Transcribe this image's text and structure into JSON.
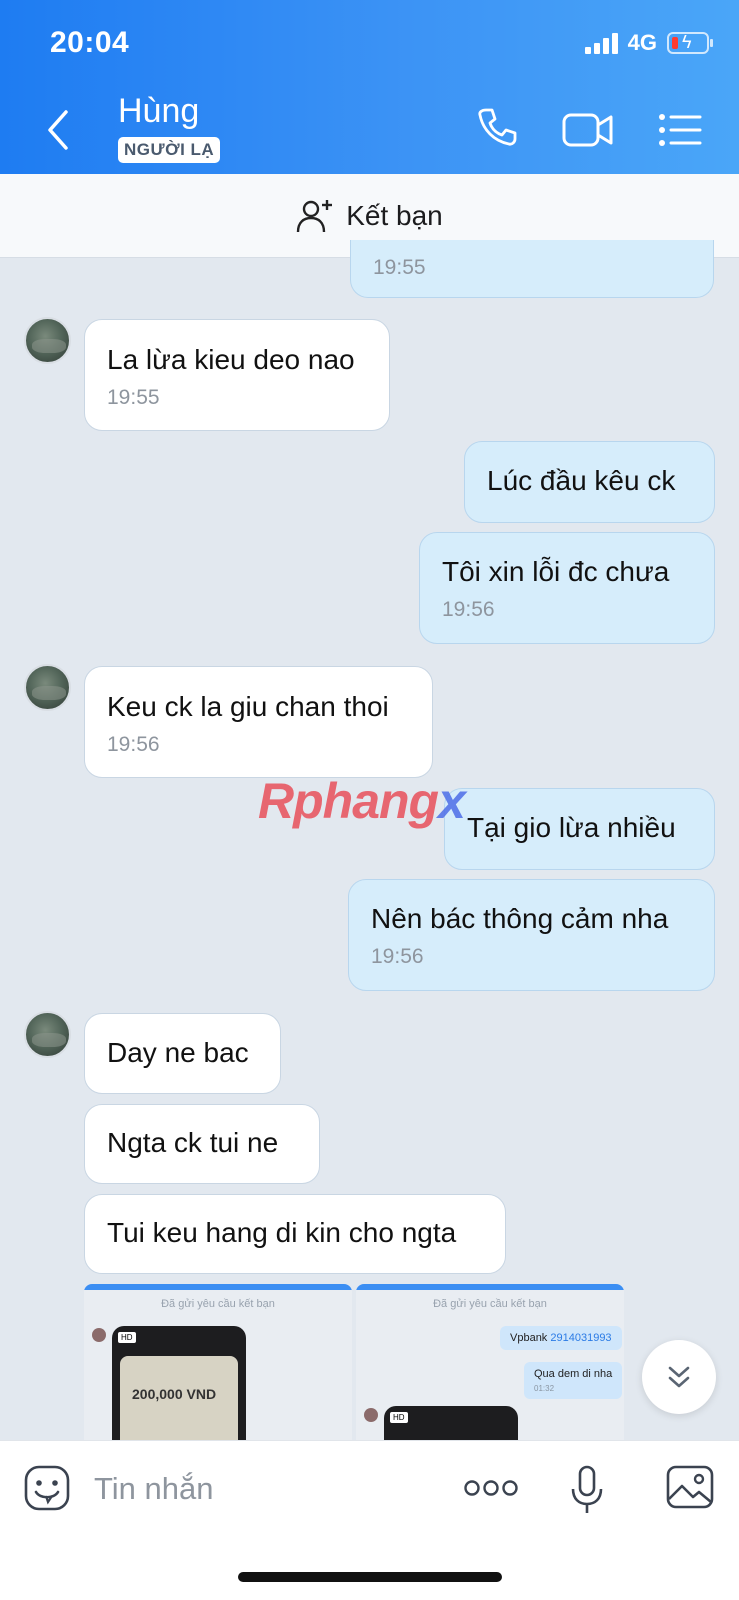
{
  "status_bar": {
    "time": "20:04",
    "network": "4G"
  },
  "header": {
    "contact_name": "Hùng",
    "badge": "NGƯỜI LẠ"
  },
  "friend_bar": {
    "label": "Kết bạn"
  },
  "messages": [
    {
      "dir": "out",
      "text": "",
      "time": "19:55"
    },
    {
      "dir": "in",
      "text": "La lừa kieu deo nao",
      "time": "19:55"
    },
    {
      "dir": "out",
      "text": "Lúc đầu kêu ck",
      "time": ""
    },
    {
      "dir": "out",
      "text": "Tôi xin lỗi đc chưa",
      "time": "19:56"
    },
    {
      "dir": "in",
      "text": "Keu ck la giu chan thoi",
      "time": "19:56"
    },
    {
      "dir": "out",
      "text": "Tại gio lừa nhiều",
      "time": ""
    },
    {
      "dir": "out",
      "text": "Nên bác thông cảm nha",
      "time": "19:56"
    },
    {
      "dir": "in",
      "text": "Day ne bac",
      "time": ""
    },
    {
      "dir": "in",
      "text": "Ngta ck tui ne",
      "time": ""
    },
    {
      "dir": "in",
      "text": "Tui keu hang di kin cho ngta",
      "time": ""
    }
  ],
  "watermark": {
    "part1": "Rphang",
    "part2": "x"
  },
  "shared_images": {
    "friend_request_text": "Đã gửi yêu cầu kết bạn",
    "amount": "200,000 VND",
    "hd": "HD",
    "bank_label": "Vpbank ",
    "account": "2914031993",
    "reply_text": "Qua dem di nha",
    "reply_time": "01:32"
  },
  "input": {
    "placeholder": "Tin nhắn"
  },
  "colors": {
    "header_blue": "#1e7cf2",
    "outgoing_bubble": "#d6edfb",
    "incoming_bubble": "#ffffff",
    "background": "#e2e8ef"
  }
}
